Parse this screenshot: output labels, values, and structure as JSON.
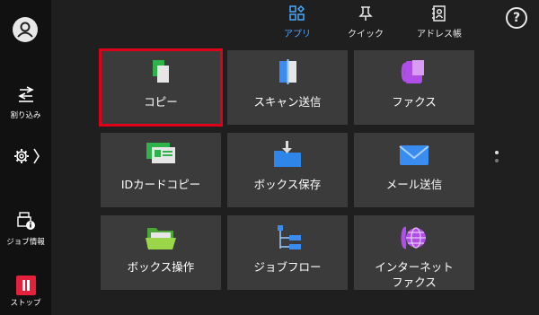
{
  "sidebar": {
    "interrupt_label": "割り込み",
    "job_info_label": "ジョブ情報",
    "stop_label": "ストップ"
  },
  "tabs": [
    {
      "label": "アプリ",
      "active": true
    },
    {
      "label": "クイック",
      "active": false
    },
    {
      "label": "アドレス帳",
      "active": false
    }
  ],
  "help_glyph": "?",
  "tiles": [
    {
      "label": "コピー",
      "icon": "copy-icon"
    },
    {
      "label": "スキャン送信",
      "icon": "scan-send-icon"
    },
    {
      "label": "ファクス",
      "icon": "fax-icon"
    },
    {
      "label": "IDカードコピー",
      "icon": "id-card-copy-icon"
    },
    {
      "label": "ボックス保存",
      "icon": "box-save-icon"
    },
    {
      "label": "メール送信",
      "icon": "mail-send-icon"
    },
    {
      "label": "ボックス操作",
      "icon": "box-operation-icon"
    },
    {
      "label": "ジョブフロー",
      "icon": "job-flow-icon"
    },
    {
      "label": "インターネット",
      "label2": "ファクス",
      "icon": "internet-fax-icon"
    }
  ],
  "colors": {
    "accent": "#4aa8ff",
    "selection": "#e00019",
    "stop": "#e4213b"
  }
}
